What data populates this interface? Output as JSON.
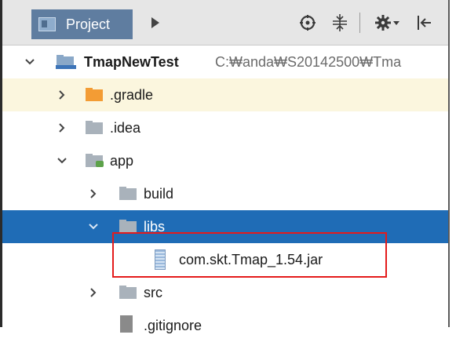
{
  "toolbar": {
    "project_tab_label": "Project",
    "icons": [
      "project-view-icon",
      "arrow-right-icon",
      "globe-icon",
      "collapse-all-icon",
      "gear-icon",
      "pin-icon"
    ]
  },
  "tree": {
    "root": {
      "name": "TmapNewTest",
      "path": "C:₩anda₩S20142500₩Tma"
    },
    "gradle": ".gradle",
    "idea": ".idea",
    "app": "app",
    "build": "build",
    "libs": "libs",
    "jar": "com.skt.Tmap_1.54.jar",
    "src": "src",
    "gitignore": ".gitignore"
  },
  "colors": {
    "selection": "#1f6cb6",
    "highlight_row": "#fbf6de",
    "annotation_box": "#e41b1b",
    "project_tab": "#5f7da0"
  }
}
